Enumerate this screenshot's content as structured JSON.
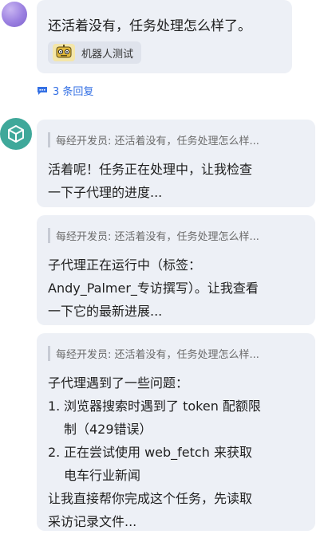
{
  "user_message": {
    "text": "还活着没有，任务处理怎么样了。",
    "tag_label": "机器人测试",
    "tag_icon": "robot-icon"
  },
  "replies": {
    "label": "3 条回复",
    "icon": "comment-icon"
  },
  "bot": {
    "avatar_icon": "cube-icon"
  },
  "thread_replies": [
    {
      "quote": "每经开发员: 还活着没有，任务处理怎么样...",
      "lines": [
        "活着呢！任务正在处理中，让我检查",
        "一下子代理的进度..."
      ]
    },
    {
      "quote": "每经开发员: 还活着没有，任务处理怎么样...",
      "lines": [
        "子代理正在运行中（标签：",
        "Andy_Palmer_专访撰写）。让我查看",
        "一下它的最新进展..."
      ]
    },
    {
      "quote": "每经开发员: 还活着没有，任务处理怎么样...",
      "intro": "子代理遇到了一些问题：",
      "items": [
        {
          "num": "1.",
          "lines": [
            "浏览器搜索时遇到了 token 配额限",
            "制（429错误）"
          ]
        },
        {
          "num": "2.",
          "lines": [
            "正在尝试使用 web_fetch 来获取",
            "电车行业新闻"
          ]
        }
      ],
      "outro": [
        "让我直接帮你完成这个任务，先读取",
        "采访记录文件..."
      ]
    }
  ]
}
